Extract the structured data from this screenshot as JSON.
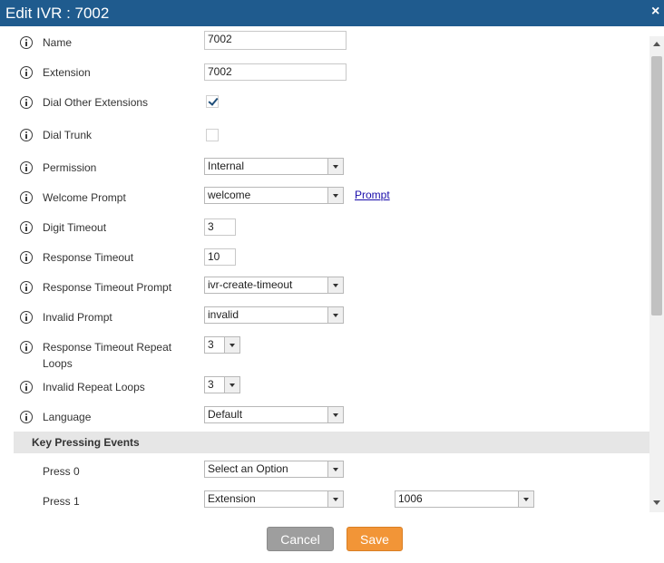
{
  "dialog": {
    "title": "Edit IVR : 7002",
    "close_icon": "×"
  },
  "fields": {
    "name": {
      "label": "Name",
      "value": "7002"
    },
    "extension": {
      "label": "Extension",
      "value": "7002"
    },
    "dial_other_extensions": {
      "label": "Dial Other Extensions",
      "checked": true
    },
    "dial_trunk": {
      "label": "Dial Trunk",
      "checked": false
    },
    "permission": {
      "label": "Permission",
      "value": "Internal"
    },
    "welcome_prompt": {
      "label": "Welcome Prompt",
      "value": "welcome",
      "link": "Prompt"
    },
    "digit_timeout": {
      "label": "Digit Timeout",
      "value": "3"
    },
    "response_timeout": {
      "label": "Response Timeout",
      "value": "10"
    },
    "response_timeout_prompt": {
      "label": "Response Timeout Prompt",
      "value": "ivr-create-timeout"
    },
    "invalid_prompt": {
      "label": "Invalid Prompt",
      "value": "invalid"
    },
    "response_timeout_repeat_loops": {
      "label_line1": "Response Timeout Repeat",
      "label_line2": "Loops",
      "value": "3"
    },
    "invalid_repeat_loops": {
      "label": "Invalid Repeat Loops",
      "value": "3"
    },
    "language": {
      "label": "Language",
      "value": "Default"
    }
  },
  "key_pressing_events": {
    "title": "Key Pressing Events",
    "press0": {
      "label": "Press 0",
      "value": "Select an Option"
    },
    "press1": {
      "label": "Press 1",
      "type_value": "Extension",
      "target_value": "1006"
    }
  },
  "buttons": {
    "cancel": "Cancel",
    "save": "Save"
  },
  "colors": {
    "titlebar": "#1f5b8e",
    "save": "#f29537",
    "cancel": "#9e9e9e",
    "link": "#1a0dab"
  }
}
